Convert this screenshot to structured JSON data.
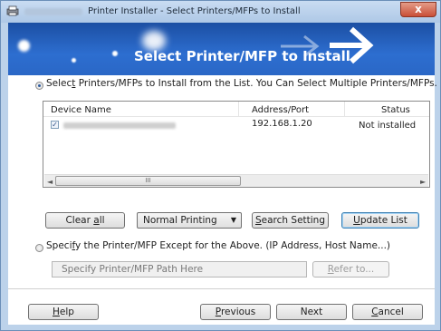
{
  "window": {
    "title": "Printer Installer - Select Printers/MFPs to Install",
    "close_label": "x"
  },
  "banner": {
    "title": "Select Printer/MFP to Install"
  },
  "select_option": {
    "label_before": "Selec",
    "label_underlined": "t",
    "label_after": " Printers/MFPs to Install from the List. You Can Select Multiple Printers/MFPs.",
    "selected": true
  },
  "device_list": {
    "columns": [
      "Device Name",
      "Address/Port",
      "Status"
    ],
    "rows": [
      {
        "checked": true,
        "address": "192.168.1.20",
        "status": "Not installed"
      }
    ],
    "scroll_thumb_grip": "III"
  },
  "buttons": {
    "clear_all_prefix": "Clear ",
    "clear_all_underlined": "a",
    "clear_all_suffix": "ll",
    "search_setting_underlined": "S",
    "search_setting_suffix": "earch Setting",
    "update_list_underlined": "U",
    "update_list_suffix": "pdate List",
    "refer_prefix": "",
    "refer_underlined": "R",
    "refer_suffix": "efer to...",
    "help_underlined": "H",
    "help_suffix": "elp",
    "previous_underlined": "P",
    "previous_suffix": "revious",
    "next_label": "Next",
    "cancel_underlined": "C",
    "cancel_suffix": "ancel"
  },
  "print_mode": {
    "selected": "Normal Printing"
  },
  "specify_option": {
    "label_before": "Speci",
    "label_underlined": "f",
    "label_after": "y the Printer/MFP Except for the Above. (IP Address, Host Name...)",
    "selected": false
  },
  "path_field": {
    "placeholder": "Specify Printer/MFP Path Here"
  }
}
